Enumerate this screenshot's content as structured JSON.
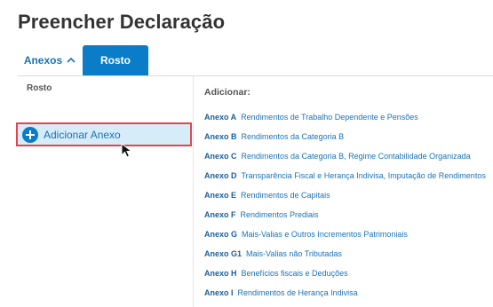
{
  "page": {
    "title": "Preencher Declaração"
  },
  "tabs": {
    "anexos_label": "Anexos",
    "rosto_label": "Rosto"
  },
  "left": {
    "section_label": "Rosto",
    "add_button_label": "Adicionar Anexo"
  },
  "right": {
    "heading": "Adicionar:",
    "items": [
      {
        "code": "Anexo A",
        "desc": "Rendimentos de Trabalho Dependente e Pensões"
      },
      {
        "code": "Anexo B",
        "desc": "Rendimentos da Categoria B"
      },
      {
        "code": "Anexo C",
        "desc": "Rendimentos da Categoria B, Regime Contabilidade Organizada"
      },
      {
        "code": "Anexo D",
        "desc": "Transparência Fiscal e Herança Indivisa, Imputação de Rendimentos"
      },
      {
        "code": "Anexo E",
        "desc": "Rendimentos de Capitais"
      },
      {
        "code": "Anexo F",
        "desc": "Rendimentos Prediais"
      },
      {
        "code": "Anexo G",
        "desc": "Mais-Valias e Outros Incrementos Patrimoniais"
      },
      {
        "code": "Anexo G1",
        "desc": "Mais-Valias não Tributadas"
      },
      {
        "code": "Anexo H",
        "desc": "Benefícios fiscais e Deduções"
      },
      {
        "code": "Anexo I",
        "desc": "Rendimentos de Herança Indivisa"
      }
    ]
  },
  "icons": {
    "tab_chevron": "chevron-up-icon",
    "add_button": "plus-circle-icon",
    "pointer": "mouse-pointer-icon"
  },
  "colors": {
    "accent": "#0a7cc8",
    "link": "#1a73b8",
    "highlight_bg": "#d6ecf9",
    "highlight_border": "#e0474c"
  }
}
